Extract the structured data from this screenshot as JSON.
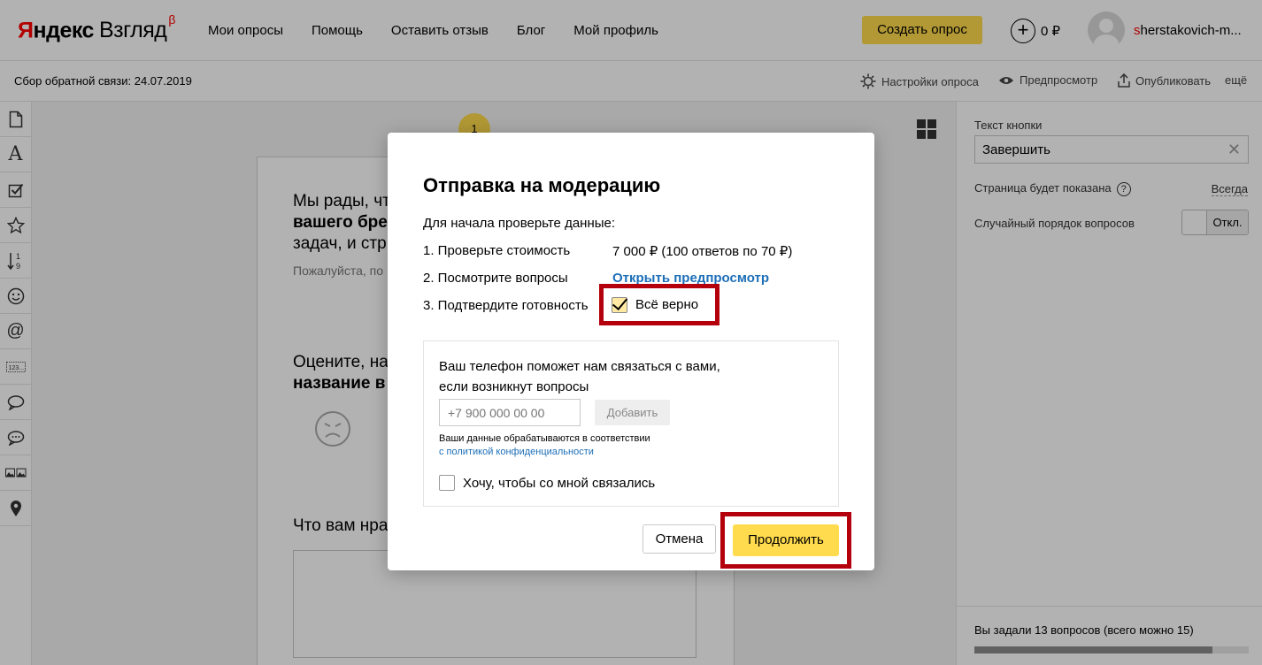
{
  "header": {
    "logo": {
      "brand_first": "Я",
      "brand_rest": "ндекс",
      "product": "Взгляд",
      "beta": "β"
    },
    "nav": [
      "Мои опросы",
      "Помощь",
      "Оставить отзыв",
      "Блог",
      "Мой профиль"
    ],
    "create_button": "Создать опрос",
    "balance": "0 ₽",
    "user": {
      "first_letter": "s",
      "rest": "herstakovich-m..."
    }
  },
  "toolbar": {
    "survey_title": "Сбор обратной связи: 24.07.2019",
    "settings": "Настройки опроса",
    "preview": "Предпросмотр",
    "publish": "Опубликовать",
    "more": "ещё"
  },
  "leftbar": {
    "tools": [
      "page-icon",
      "text-icon",
      "checkbox-icon",
      "star-icon",
      "sort-icon",
      "smiley-icon",
      "at-sign-icon",
      "number-icon",
      "speech-bubble-icon",
      "chat-bubbles-icon",
      "images-icon",
      "map-pin-icon"
    ]
  },
  "canvas": {
    "page_number": "1",
    "intro_line1": "Мы рады, чт",
    "intro_line2_bold": "вашего бре",
    "intro_line3": "задач, и стр",
    "hint": "Пожалуйста, по",
    "q2_line1": "Оцените, на",
    "q2_line2_bold": "название в",
    "q3": "Что вам нра"
  },
  "right_panel": {
    "button_text_label": "Текст кнопки",
    "button_text_value": "Завершить",
    "page_shown_label": "Страница будет показана",
    "help_glyph": "?",
    "page_shown_value": "Всегда",
    "random_order_label": "Случайный порядок вопросов",
    "random_order_state": "Откл.",
    "questions_counter": "Вы задали 13 вопросов (всего можно 15)",
    "questions_progress": 0.867
  },
  "modal": {
    "title": "Отправка на модерацию",
    "intro": "Для начала проверьте данные:",
    "step1": "1. Проверьте стоимость",
    "step1_value": "7 000 ₽ (100 ответов по 70 ₽)",
    "step2": "2. Посмотрите вопросы",
    "step2_link": "Открыть предпросмотр",
    "step3": "3. Подтвердите готовность",
    "confirm_label": "Всё верно",
    "confirm_checked": true,
    "phone_text_line1": "Ваш телефон поможет нам связаться с вами,",
    "phone_text_line2": "если возникнут вопросы",
    "phone_placeholder": "+7 900 000 00 00",
    "add_button": "Добавить",
    "privacy_note": "Ваши данные обрабатываются в соответствии",
    "privacy_link": "с политикой конфиденциальности",
    "contact_me_label": "Хочу, чтобы со мной связались",
    "contact_me_checked": false,
    "cancel_button": "Отмена",
    "continue_button": "Продолжить",
    "highlight_color": "#b3000c",
    "accent_color": "#ffdb4d",
    "link_color": "#1d6fb8"
  }
}
